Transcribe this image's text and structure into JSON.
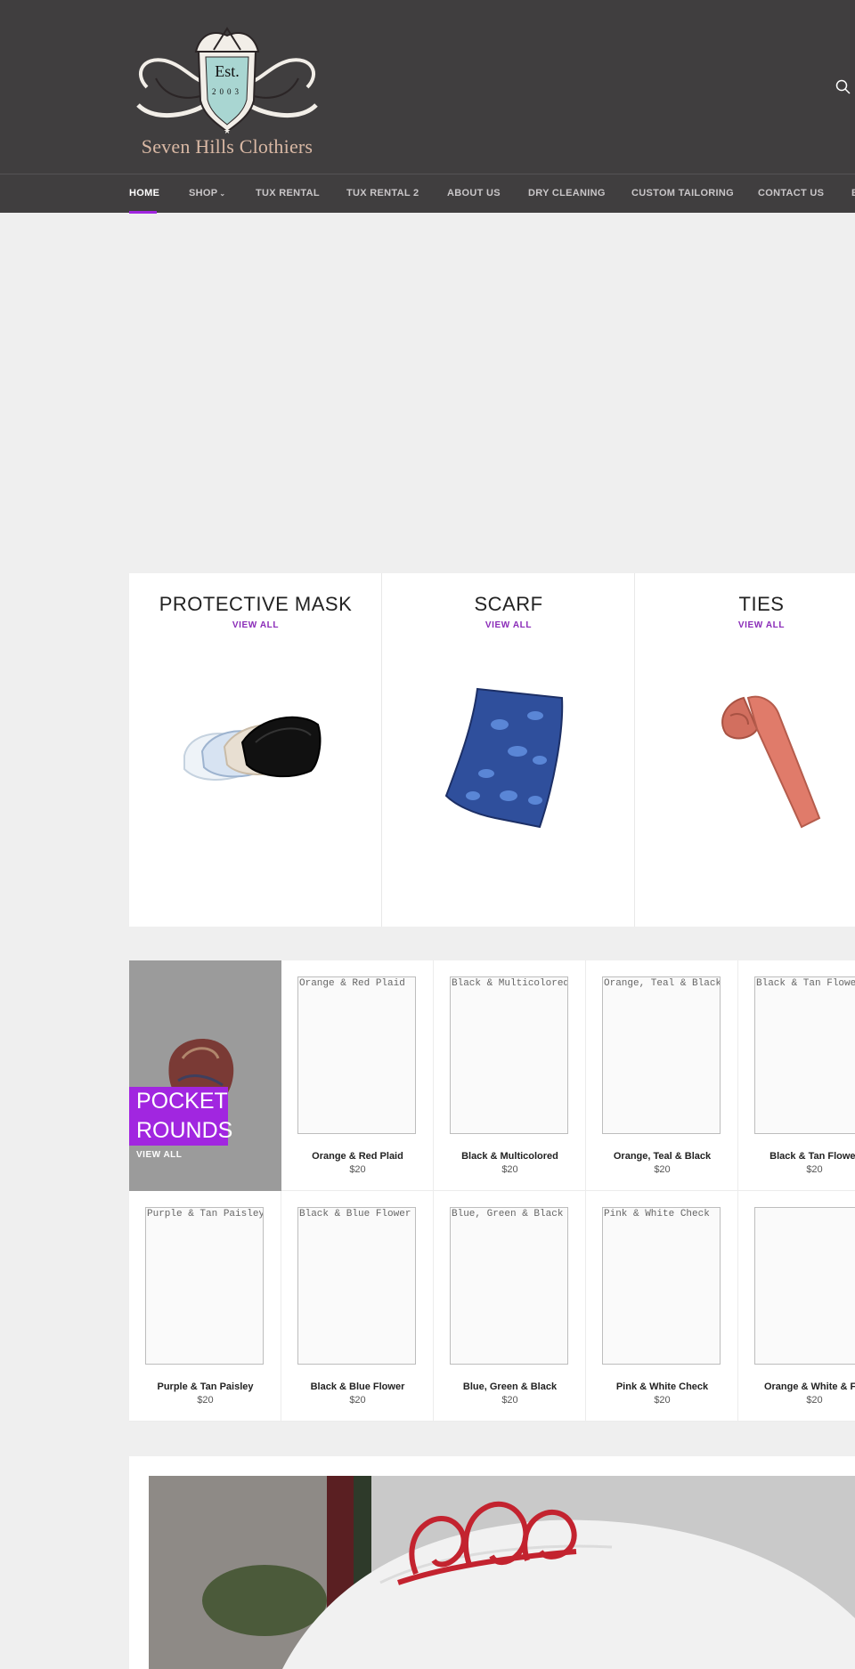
{
  "header": {
    "logo_alt": "Seven Hills Clothiers",
    "logo_text": "Seven Hills Clothiers",
    "logo_badge_est": "Est.",
    "logo_badge_year": "2003",
    "search_icon": "search-icon"
  },
  "nav": {
    "items": [
      {
        "label": "HOME"
      },
      {
        "label": "SHOP"
      },
      {
        "label": "TUX RENTAL"
      },
      {
        "label": "TUX RENTAL 2"
      },
      {
        "label": "ABOUT US"
      },
      {
        "label": "DRY CLEANING"
      },
      {
        "label": "CUSTOM TAILORING"
      },
      {
        "label": "CONTACT US"
      },
      {
        "label": "B"
      }
    ],
    "active_color": "#a126e0"
  },
  "collections": [
    {
      "title": "PROTECTIVE MASK",
      "link": "VIEW ALL"
    },
    {
      "title": "SCARF",
      "link": "VIEW ALL"
    },
    {
      "title": "TIES",
      "link": "VIEW ALL"
    }
  ],
  "featured": {
    "title_line1": "POCKET",
    "title_line2": "ROUNDS",
    "link": "VIEW ALL"
  },
  "products": [
    {
      "alt": "Orange & Red Plaid",
      "name": "Orange & Red Plaid",
      "price": "$20"
    },
    {
      "alt": "Black & Multicolored",
      "name": "Black & Multicolored",
      "price": "$20"
    },
    {
      "alt": "Orange, Teal & Black",
      "name": "Orange, Teal & Black",
      "price": "$20"
    },
    {
      "alt": "Black & Tan Flower",
      "name": "Black & Tan Flower",
      "price": "$20"
    },
    {
      "alt": "Purple & Tan Paisley",
      "name": "Purple & Tan Paisley",
      "price": "$20"
    },
    {
      "alt": "Black & Blue Flower",
      "name": "Black & Blue Flower",
      "price": "$20"
    },
    {
      "alt": "Blue, Green & Black",
      "name": "Blue, Green & Black",
      "price": "$20"
    },
    {
      "alt": "Pink & White Check",
      "name": "Pink & White Check",
      "price": "$20"
    },
    {
      "alt": "",
      "name": "Orange & White & Flo",
      "price": "$20"
    }
  ],
  "colors": {
    "header_bg": "#403e3f",
    "accent": "#a126e0",
    "link_purple": "#8a2bb8",
    "page_bg": "#efefef"
  }
}
